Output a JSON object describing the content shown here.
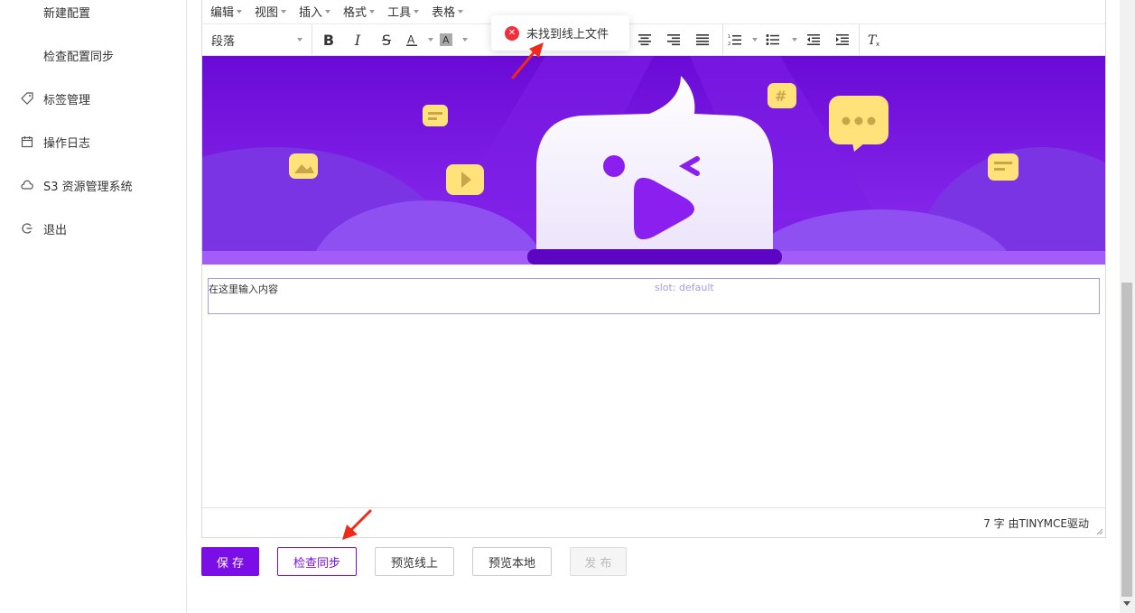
{
  "sidebar": {
    "items": [
      {
        "label": "新建配置",
        "icon": "none"
      },
      {
        "label": "检查配置同步",
        "icon": "none"
      },
      {
        "label": "标签管理",
        "icon": "tag-icon"
      },
      {
        "label": "操作日志",
        "icon": "calendar-icon"
      },
      {
        "label": "S3 资源管理系统",
        "icon": "cloud-icon"
      },
      {
        "label": "退出",
        "icon": "logout-icon"
      }
    ]
  },
  "editor": {
    "menus": [
      "编辑",
      "视图",
      "插入",
      "格式",
      "工具",
      "表格"
    ],
    "block_format": "段落",
    "placeholder": "在这里输入内容",
    "slot_label": "slot: default",
    "status": "7 字 由TINYMCE驱动"
  },
  "buttons": {
    "save": "保 存",
    "check_sync": "检查同步",
    "preview_online": "预览线上",
    "preview_local": "预览本地",
    "publish": "发 布"
  },
  "toast": {
    "message": "未找到线上文件",
    "type": "error"
  },
  "colors": {
    "accent": "#7b0de6",
    "error": "#f02d3c",
    "banner": "#6a0ad6"
  }
}
